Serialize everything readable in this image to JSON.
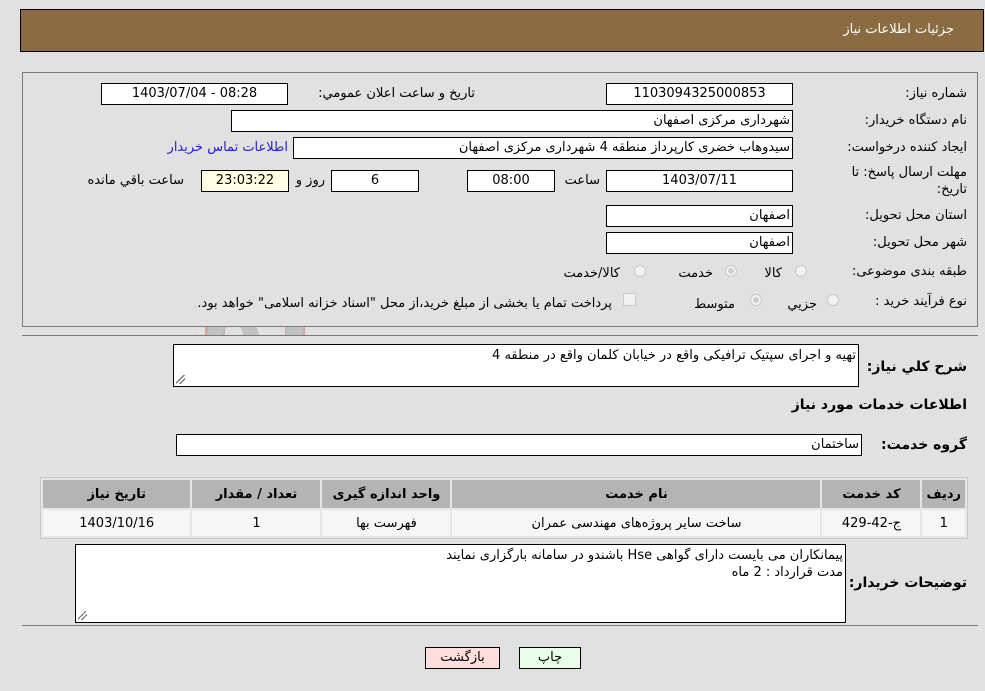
{
  "header": {
    "title": "جزئیات اطلاعات نیاز"
  },
  "fields": {
    "need_number": {
      "label": "شماره نیاز:",
      "value": "1103094325000853"
    },
    "announce_datetime": {
      "label": "تاریخ و ساعت اعلان عمومي:",
      "value": "1403/07/04 - 08:28"
    },
    "buyer_org": {
      "label": "نام دستگاه خریدار:",
      "value": "شهرداری مرکزی اصفهان"
    },
    "requester": {
      "label": "ایجاد کننده درخواست:",
      "value": "سیدوهاب خضری کارپرداز منطقه 4 شهرداری مرکزی اصفهان"
    },
    "buyer_contact_link": "اطلاعات تماس خریدار",
    "deadline": {
      "label_line1": "مهلت ارسال پاسخ: تا",
      "label_line2": "تاریخ:",
      "date": "1403/07/11",
      "time_label": "ساعت",
      "time": "08:00",
      "days": "6",
      "days_label": "روز و",
      "remaining": "23:03:22",
      "remaining_label": "ساعت باقي مانده"
    },
    "province": {
      "label": "استان محل تحویل:",
      "value": "اصفهان"
    },
    "city": {
      "label": "شهر محل تحویل:",
      "value": "اصفهان"
    },
    "category": {
      "label": "طبقه بندی موضوعی:",
      "options": [
        "کالا",
        "خدمت",
        "کالا/خدمت"
      ],
      "selected": "خدمت"
    },
    "purchase_type": {
      "label": "نوع فرآیند خرید :",
      "options": [
        "جزیي",
        "متوسط"
      ],
      "selected": "متوسط",
      "treasury_note": "پرداخت تمام یا بخشی از مبلغ خرید،از محل \"اسناد خزانه اسلامی\" خواهد بود.",
      "treasury_checked": false
    }
  },
  "description": {
    "label": "شرح کلي نیاز:",
    "value": "تهیه و اجرای سپتیک ترافیکی واقع در خیابان کلمان واقع در منطقه 4"
  },
  "services_section": {
    "title": "اطلاعات خدمات مورد نیاز"
  },
  "service_group": {
    "label": "گروه خدمت:",
    "value": "ساختمان"
  },
  "table": {
    "headers": [
      "ردیف",
      "کد خدمت",
      "نام خدمت",
      "واحد اندازه گیری",
      "تعداد / مقدار",
      "تاریخ نیاز"
    ],
    "rows": [
      [
        "1",
        "ج-42-429",
        "ساخت سایر پروژه‌های مهندسی عمران",
        "فهرست بها",
        "1",
        "1403/10/16"
      ]
    ]
  },
  "buyer_notes": {
    "label": "توضیحات خریدار:",
    "line1": "پیمانکاران می بایست دارای گواهی Hse باشندو در سامانه بارگزاری نمایند",
    "line2": "مدت قرارداد : 2 ماه"
  },
  "buttons": {
    "print": "چاپ",
    "back": "بازگشت"
  },
  "watermark": {
    "text": "AriaTender.neT",
    "color": "#c0392b"
  }
}
